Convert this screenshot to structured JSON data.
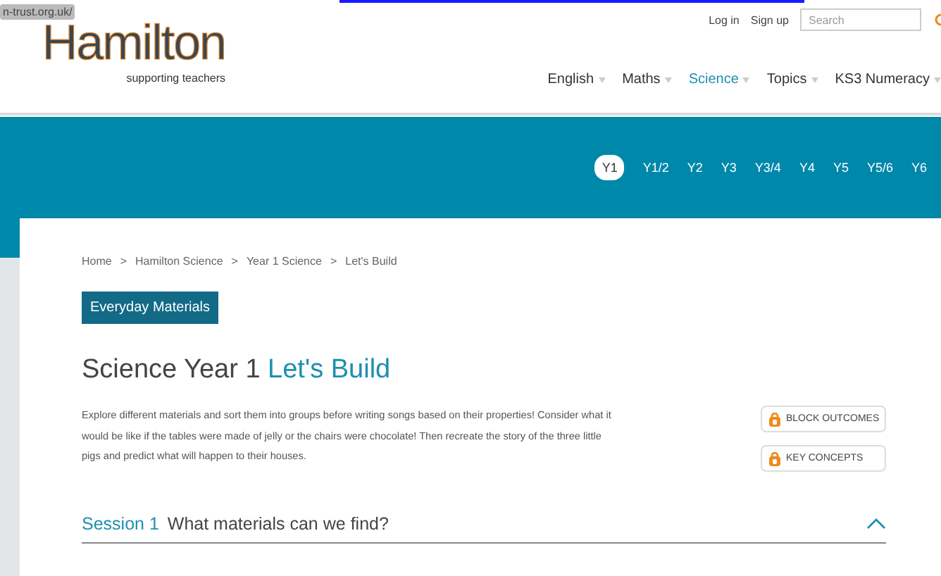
{
  "url_tooltip": "n-trust.org.uk/",
  "logo": {
    "name": "Hamilton",
    "tagline": "supporting teachers"
  },
  "account_links": [
    "Log in",
    "Sign up"
  ],
  "search": {
    "placeholder": "Search"
  },
  "main_nav": [
    {
      "label": "English",
      "selected": false
    },
    {
      "label": "Maths",
      "selected": false
    },
    {
      "label": "Science",
      "selected": true
    },
    {
      "label": "Topics",
      "selected": false
    },
    {
      "label": "KS3 Numeracy",
      "selected": false
    }
  ],
  "year_tabs": [
    {
      "label": "Y1",
      "selected": true
    },
    {
      "label": "Y1/2",
      "selected": false
    },
    {
      "label": "Y2",
      "selected": false
    },
    {
      "label": "Y3",
      "selected": false
    },
    {
      "label": "Y3/4",
      "selected": false
    },
    {
      "label": "Y4",
      "selected": false
    },
    {
      "label": "Y5",
      "selected": false
    },
    {
      "label": "Y5/6",
      "selected": false
    },
    {
      "label": "Y6",
      "selected": false
    }
  ],
  "breadcrumb": [
    "Home",
    "Hamilton Science",
    "Year 1 Science",
    "Let's Build"
  ],
  "breadcrumb_separator": ">",
  "tag": "Everyday Materials",
  "title": {
    "prefix": "Science Year 1",
    "highlight": "Let's Build"
  },
  "description": "Explore different materials and sort them into groups before writing songs based on their properties! Consider what it would be like if the tables were made of jelly or the chairs were chocolate! Then recreate the story of the three little pigs and predict what will happen to their houses.",
  "resource_buttons": [
    "BLOCK OUTCOMES",
    "KEY CONCEPTS"
  ],
  "session": {
    "number": "Session 1",
    "title": "What materials can we find?",
    "expanded": true
  }
}
